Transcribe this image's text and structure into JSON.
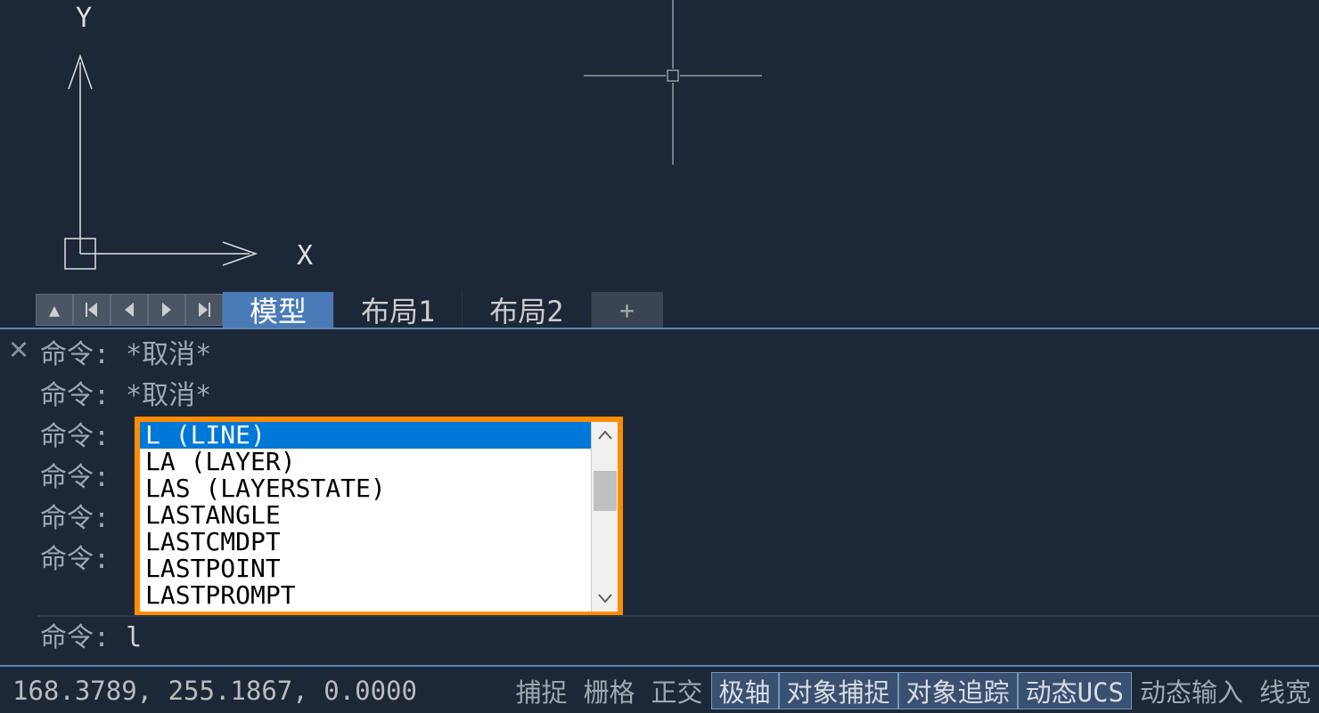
{
  "ucs": {
    "x_label": "X",
    "y_label": "Y"
  },
  "tabs": {
    "model": "模型",
    "layout1": "布局1",
    "layout2": "布局2",
    "plus": "+"
  },
  "cmd_history": [
    "命令: *取消*",
    "命令: *取消*",
    "命令:",
    "命令:",
    "命令:",
    "命令:"
  ],
  "cmd_input": {
    "label": "命令:",
    "value": "l"
  },
  "autocomplete": {
    "items": [
      "L (LINE)",
      "LA (LAYER)",
      "LAS (LAYERSTATE)",
      "LASTANGLE",
      "LASTCMDPT",
      "LASTPOINT",
      "LASTPROMPT"
    ],
    "selected_index": 0
  },
  "coords": "168.3789, 255.1867, 0.0000",
  "status_buttons": [
    {
      "label": "捕捉",
      "active": false
    },
    {
      "label": "栅格",
      "active": false
    },
    {
      "label": "正交",
      "active": false
    },
    {
      "label": "极轴",
      "active": true
    },
    {
      "label": "对象捕捉",
      "active": true
    },
    {
      "label": "对象追踪",
      "active": true
    },
    {
      "label": "动态UCS",
      "active": true
    },
    {
      "label": "动态输入",
      "active": false
    },
    {
      "label": "线宽",
      "active": false
    }
  ]
}
